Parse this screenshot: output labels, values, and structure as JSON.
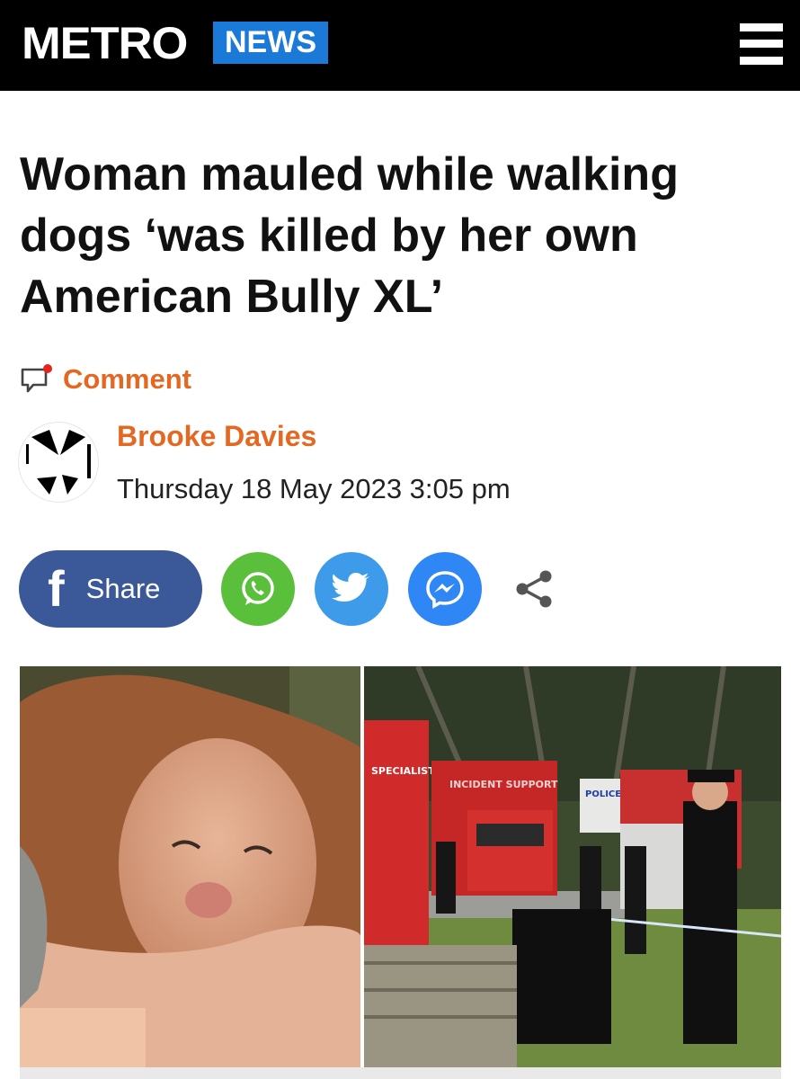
{
  "header": {
    "logo_text": "METRO",
    "section_tag": "NEWS",
    "menu_icon": "hamburger-menu-icon",
    "background_color": "#000000",
    "tag_color": "#1b79d8"
  },
  "article": {
    "headline": "Woman mauled while walking dogs ‘was killed by her own American Bully XL’",
    "comment_label": "Comment",
    "author_name": "Brooke Davies",
    "date": "Thursday 18 May 2023 3:05 pm",
    "accent_color": "#e46821"
  },
  "share": {
    "facebook_label": "Share",
    "buttons": [
      {
        "icon": "facebook-icon",
        "color": "#3b5998"
      },
      {
        "icon": "whatsapp-icon",
        "color": "#5ac03c"
      },
      {
        "icon": "twitter-icon",
        "color": "#3d9be9"
      },
      {
        "icon": "messenger-icon",
        "color": "#2f86f5"
      },
      {
        "icon": "share-icon",
        "color": "#555555"
      }
    ]
  },
  "images": {
    "left": {
      "icon": "woman-photo"
    },
    "right": {
      "icon": "police-scene-photo",
      "van_side_text": "SPECIALIST RESCUE",
      "van_top_text": "INCIDENT SUPPORT",
      "police_van_text": "POLICE"
    }
  }
}
